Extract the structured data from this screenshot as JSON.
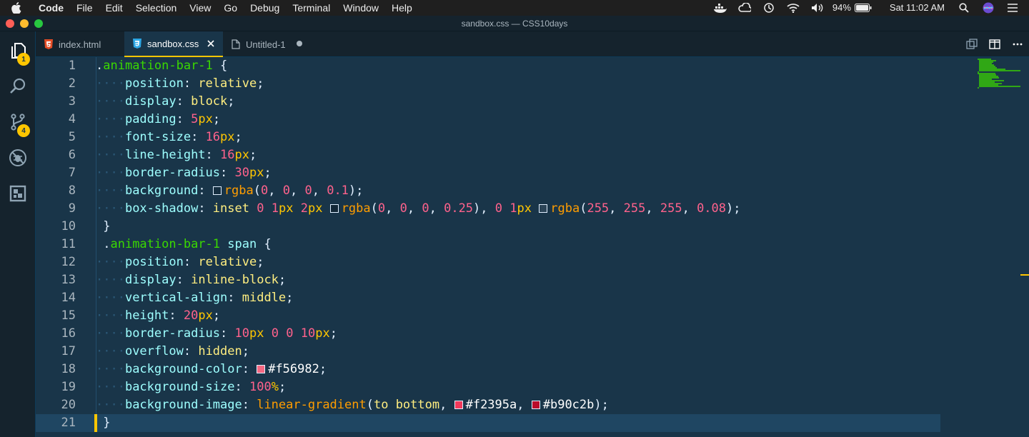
{
  "menubar": {
    "app_name": "Code",
    "items": [
      "File",
      "Edit",
      "Selection",
      "View",
      "Go",
      "Debug",
      "Terminal",
      "Window",
      "Help"
    ],
    "battery": "94%",
    "clock": "Sat 11:02 AM"
  },
  "window": {
    "title": "sandbox.css — CSS10days"
  },
  "activity": {
    "explorer_badge": "1",
    "scm_badge": "4"
  },
  "tabs": [
    {
      "label": "index.html",
      "icon": "html5-icon",
      "active": false
    },
    {
      "label": "sandbox.css",
      "icon": "css3-icon",
      "active": true
    },
    {
      "label": "Untitled-1",
      "icon": "file-icon",
      "active": false
    }
  ],
  "editor": {
    "cursor_line": 21,
    "lines": [
      {
        "n": "1",
        "tokens": [
          [
            "punct",
            "."
          ],
          [
            "sel",
            "animation-bar-1"
          ],
          [
            "punct",
            " {"
          ]
        ]
      },
      {
        "n": "2",
        "indent": true,
        "tokens": [
          [
            "prop",
            "position"
          ],
          [
            "punct",
            ": "
          ],
          [
            "val",
            "relative"
          ],
          [
            "punct",
            ";"
          ]
        ]
      },
      {
        "n": "3",
        "indent": true,
        "tokens": [
          [
            "prop",
            "display"
          ],
          [
            "punct",
            ": "
          ],
          [
            "val",
            "block"
          ],
          [
            "punct",
            ";"
          ]
        ]
      },
      {
        "n": "4",
        "indent": true,
        "tokens": [
          [
            "prop",
            "padding"
          ],
          [
            "punct",
            ": "
          ],
          [
            "num",
            "5"
          ],
          [
            "unit",
            "px"
          ],
          [
            "punct",
            ";"
          ]
        ]
      },
      {
        "n": "5",
        "indent": true,
        "tokens": [
          [
            "prop",
            "font-size"
          ],
          [
            "punct",
            ": "
          ],
          [
            "num",
            "16"
          ],
          [
            "unit",
            "px"
          ],
          [
            "punct",
            ";"
          ]
        ]
      },
      {
        "n": "6",
        "indent": true,
        "tokens": [
          [
            "prop",
            "line-height"
          ],
          [
            "punct",
            ": "
          ],
          [
            "num",
            "16"
          ],
          [
            "unit",
            "px"
          ],
          [
            "punct",
            ";"
          ]
        ]
      },
      {
        "n": "7",
        "indent": true,
        "tokens": [
          [
            "prop",
            "border-radius"
          ],
          [
            "punct",
            ": "
          ],
          [
            "num",
            "30"
          ],
          [
            "unit",
            "px"
          ],
          [
            "punct",
            ";"
          ]
        ]
      },
      {
        "n": "8",
        "indent": true,
        "tokens": [
          [
            "prop",
            "background"
          ],
          [
            "punct",
            ": "
          ],
          [
            "swatch",
            "rgba(0,0,0,0.1)"
          ],
          [
            "fn",
            "rgba"
          ],
          [
            "punct",
            "("
          ],
          [
            "num",
            "0"
          ],
          [
            "punct",
            ", "
          ],
          [
            "num",
            "0"
          ],
          [
            "punct",
            ", "
          ],
          [
            "num",
            "0"
          ],
          [
            "punct",
            ", "
          ],
          [
            "num",
            "0.1"
          ],
          [
            "punct",
            ");"
          ]
        ]
      },
      {
        "n": "9",
        "indent": true,
        "tokens": [
          [
            "prop",
            "box-shadow"
          ],
          [
            "punct",
            ": "
          ],
          [
            "val",
            "inset "
          ],
          [
            "num",
            "0"
          ],
          [
            "punct",
            " "
          ],
          [
            "num",
            "1"
          ],
          [
            "unit",
            "px"
          ],
          [
            "punct",
            " "
          ],
          [
            "num",
            "2"
          ],
          [
            "unit",
            "px"
          ],
          [
            "punct",
            " "
          ],
          [
            "swatch",
            "rgba(0,0,0,0.25)"
          ],
          [
            "fn",
            "rgba"
          ],
          [
            "punct",
            "("
          ],
          [
            "num",
            "0"
          ],
          [
            "punct",
            ", "
          ],
          [
            "num",
            "0"
          ],
          [
            "punct",
            ", "
          ],
          [
            "num",
            "0"
          ],
          [
            "punct",
            ", "
          ],
          [
            "num",
            "0.25"
          ],
          [
            "punct",
            "), "
          ],
          [
            "num",
            "0"
          ],
          [
            "punct",
            " "
          ],
          [
            "num",
            "1"
          ],
          [
            "unit",
            "px"
          ],
          [
            "punct",
            " "
          ],
          [
            "swatch",
            "rgba(255,255,255,0.08)"
          ],
          [
            "fn",
            "rgba"
          ],
          [
            "punct",
            "("
          ],
          [
            "num",
            "255"
          ],
          [
            "punct",
            ", "
          ],
          [
            "num",
            "255"
          ],
          [
            "punct",
            ", "
          ],
          [
            "num",
            "255"
          ],
          [
            "punct",
            ", "
          ],
          [
            "num",
            "0.08"
          ],
          [
            "punct",
            ");"
          ]
        ]
      },
      {
        "n": "10",
        "tokens": [
          [
            "punct",
            " }"
          ]
        ]
      },
      {
        "n": "11",
        "tokens": [
          [
            "punct",
            " ."
          ],
          [
            "sel",
            "animation-bar-1"
          ],
          [
            "punct",
            " "
          ],
          [
            "tag",
            "span"
          ],
          [
            "punct",
            " {"
          ]
        ]
      },
      {
        "n": "12",
        "indent": true,
        "tokens": [
          [
            "prop",
            "position"
          ],
          [
            "punct",
            ": "
          ],
          [
            "val",
            "relative"
          ],
          [
            "punct",
            ";"
          ]
        ]
      },
      {
        "n": "13",
        "indent": true,
        "tokens": [
          [
            "prop",
            "display"
          ],
          [
            "punct",
            ": "
          ],
          [
            "val",
            "inline-block"
          ],
          [
            "punct",
            ";"
          ]
        ]
      },
      {
        "n": "14",
        "indent": true,
        "tokens": [
          [
            "prop",
            "vertical-align"
          ],
          [
            "punct",
            ": "
          ],
          [
            "val",
            "middle"
          ],
          [
            "punct",
            ";"
          ]
        ]
      },
      {
        "n": "15",
        "indent": true,
        "tokens": [
          [
            "prop",
            "height"
          ],
          [
            "punct",
            ": "
          ],
          [
            "num",
            "20"
          ],
          [
            "unit",
            "px"
          ],
          [
            "punct",
            ";"
          ]
        ]
      },
      {
        "n": "16",
        "indent": true,
        "tokens": [
          [
            "prop",
            "border-radius"
          ],
          [
            "punct",
            ": "
          ],
          [
            "num",
            "10"
          ],
          [
            "unit",
            "px"
          ],
          [
            "punct",
            " "
          ],
          [
            "num",
            "0"
          ],
          [
            "punct",
            " "
          ],
          [
            "num",
            "0"
          ],
          [
            "punct",
            " "
          ],
          [
            "num",
            "10"
          ],
          [
            "unit",
            "px"
          ],
          [
            "punct",
            ";"
          ]
        ]
      },
      {
        "n": "17",
        "indent": true,
        "tokens": [
          [
            "prop",
            "overflow"
          ],
          [
            "punct",
            ": "
          ],
          [
            "val",
            "hidden"
          ],
          [
            "punct",
            ";"
          ]
        ]
      },
      {
        "n": "18",
        "indent": true,
        "tokens": [
          [
            "prop",
            "background-color"
          ],
          [
            "punct",
            ": "
          ],
          [
            "swatch",
            "#f56982"
          ],
          [
            "hex",
            "#f56982"
          ],
          [
            "punct",
            ";"
          ]
        ]
      },
      {
        "n": "19",
        "indent": true,
        "tokens": [
          [
            "prop",
            "background-size"
          ],
          [
            "punct",
            ": "
          ],
          [
            "num",
            "100"
          ],
          [
            "unit",
            "%"
          ],
          [
            "punct",
            ";"
          ]
        ]
      },
      {
        "n": "20",
        "indent": true,
        "tokens": [
          [
            "prop",
            "background-image"
          ],
          [
            "punct",
            ": "
          ],
          [
            "fn",
            "linear-gradient"
          ],
          [
            "punct",
            "("
          ],
          [
            "val",
            "to bottom"
          ],
          [
            "punct",
            ", "
          ],
          [
            "swatch",
            "#f2395a"
          ],
          [
            "hex",
            "#f2395a"
          ],
          [
            "punct",
            ", "
          ],
          [
            "swatch",
            "#b90c2b"
          ],
          [
            "hex",
            "#b90c2b"
          ],
          [
            "punct",
            ");"
          ]
        ]
      },
      {
        "n": "21",
        "tokens": [
          [
            "punct",
            " }"
          ]
        ]
      }
    ]
  },
  "colors": {
    "editor_bg": "#193549",
    "accent": "#ffc600",
    "selector": "#3ad900",
    "property": "#9effff",
    "value": "#ffee80",
    "number": "#ff628c",
    "function": "#ff9d00"
  }
}
